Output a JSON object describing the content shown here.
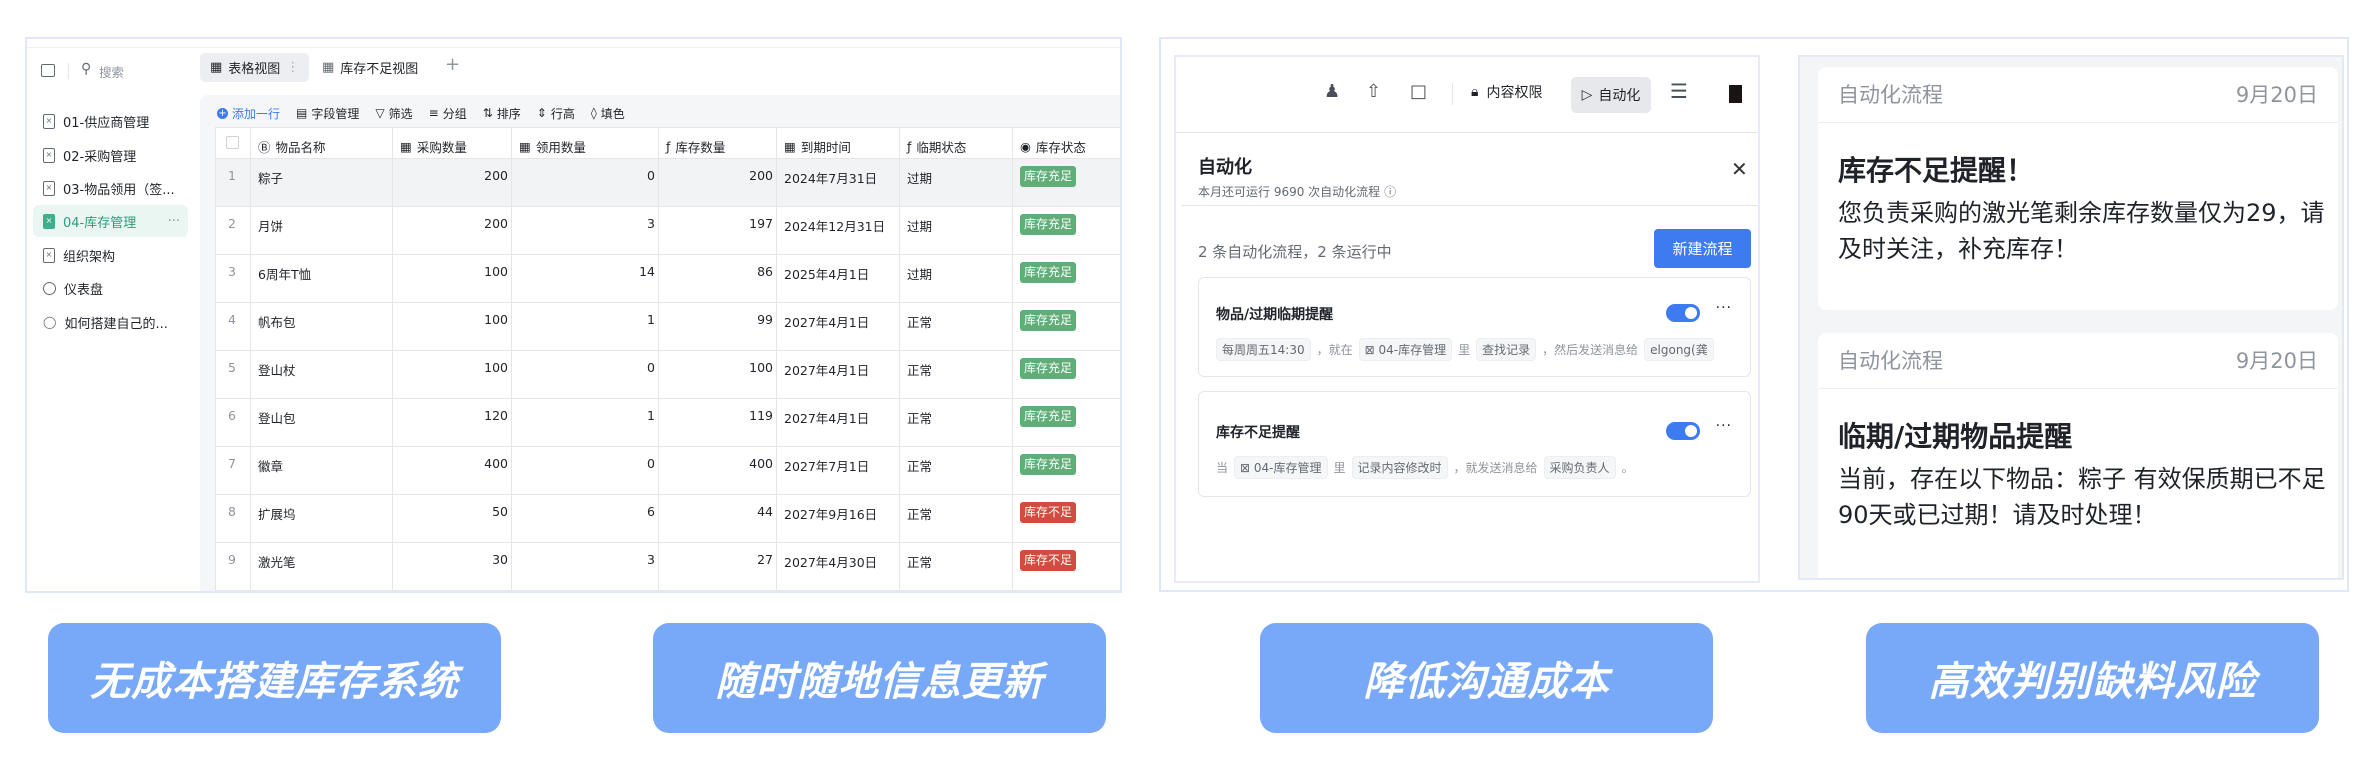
{
  "colors": {
    "accent": "#3c7cf0",
    "feature_button": "#78a8f8",
    "badge_ok": "#5fae78",
    "badge_low": "#d14b3f",
    "active_sheet": "#2d9c7a"
  },
  "sidebar": {
    "search_placeholder": "搜索",
    "items": [
      {
        "label": "01-供应商管理",
        "icon": "sheet-icon"
      },
      {
        "label": "02-采购管理",
        "icon": "sheet-icon"
      },
      {
        "label": "03-物品领用（签...",
        "icon": "sheet-icon"
      },
      {
        "label": "04-库存管理",
        "icon": "sheet-icon",
        "active": true
      },
      {
        "label": "组织架构",
        "icon": "sheet-icon"
      },
      {
        "label": "仪表盘",
        "icon": "dashboard-icon"
      },
      {
        "label": "如何搭建自己的...",
        "icon": "lightbulb-icon"
      }
    ]
  },
  "tabs": [
    {
      "label": "表格视图",
      "active": true
    },
    {
      "label": "库存不足视图"
    }
  ],
  "toolbar": {
    "add_row": "添加一行",
    "fields": "字段管理",
    "filter": "筛选",
    "group": "分组",
    "sort": "排序",
    "row_height": "行高",
    "fill": "填色"
  },
  "table": {
    "columns": [
      "物品名称",
      "采购数量",
      "领用数量",
      "库存数量",
      "到期时间",
      "临期状态",
      "库存状态"
    ],
    "rows": [
      {
        "n": "1",
        "name": "粽子",
        "purchase": "200",
        "used": "0",
        "stock": "200",
        "expire": "2024年7月31日",
        "state": "过期",
        "status": "库存充足",
        "ok": true
      },
      {
        "n": "2",
        "name": "月饼",
        "purchase": "200",
        "used": "3",
        "stock": "197",
        "expire": "2024年12月31日",
        "state": "过期",
        "status": "库存充足",
        "ok": true
      },
      {
        "n": "3",
        "name": "6周年T恤",
        "purchase": "100",
        "used": "14",
        "stock": "86",
        "expire": "2025年4月1日",
        "state": "过期",
        "status": "库存充足",
        "ok": true
      },
      {
        "n": "4",
        "name": "帆布包",
        "purchase": "100",
        "used": "1",
        "stock": "99",
        "expire": "2027年4月1日",
        "state": "正常",
        "status": "库存充足",
        "ok": true
      },
      {
        "n": "5",
        "name": "登山杖",
        "purchase": "100",
        "used": "0",
        "stock": "100",
        "expire": "2027年4月1日",
        "state": "正常",
        "status": "库存充足",
        "ok": true
      },
      {
        "n": "6",
        "name": "登山包",
        "purchase": "120",
        "used": "1",
        "stock": "119",
        "expire": "2027年4月1日",
        "state": "正常",
        "status": "库存充足",
        "ok": true
      },
      {
        "n": "7",
        "name": "徽章",
        "purchase": "400",
        "used": "0",
        "stock": "400",
        "expire": "2027年7月1日",
        "state": "正常",
        "status": "库存充足",
        "ok": true
      },
      {
        "n": "8",
        "name": "扩展坞",
        "purchase": "50",
        "used": "6",
        "stock": "44",
        "expire": "2027年9月16日",
        "state": "正常",
        "status": "库存不足",
        "ok": false
      },
      {
        "n": "9",
        "name": "激光笔",
        "purchase": "30",
        "used": "3",
        "stock": "27",
        "expire": "2027年4月30日",
        "state": "正常",
        "status": "库存不足",
        "ok": false
      }
    ]
  },
  "automation": {
    "topbar": {
      "permissions": "内容权限",
      "automation": "自动化"
    },
    "title": "自动化",
    "subtitle": "本月还可运行 9690 次自动化流程",
    "summary": "2 条自动化流程，2 条运行中",
    "new_button": "新建流程",
    "flows": [
      {
        "title": "物品/过期临期提醒",
        "enabled": true,
        "parts": [
          {
            "t": "每周周五14:30",
            "tag": true
          },
          {
            "t": "，就在"
          },
          {
            "t": "04-库存管理",
            "tag": true,
            "sheet": true
          },
          {
            "t": "里"
          },
          {
            "t": "查找记录",
            "tag": true
          },
          {
            "t": "，然后发送消息给"
          },
          {
            "t": "elgong(龚",
            "tag": true
          }
        ]
      },
      {
        "title": "库存不足提醒",
        "enabled": true,
        "parts": [
          {
            "t": "当"
          },
          {
            "t": "04-库存管理",
            "tag": true,
            "sheet": true
          },
          {
            "t": "里"
          },
          {
            "t": "记录内容修改时",
            "tag": true
          },
          {
            "t": "，就发送消息给"
          },
          {
            "t": "采购负责人",
            "tag": true
          },
          {
            "t": "。"
          }
        ]
      }
    ]
  },
  "notifications": [
    {
      "source": "自动化流程",
      "date": "9月20日",
      "title": "库存不足提醒！",
      "body": "您负责采购的激光笔剩余库存数量仅为29，请及时关注，补充库存！"
    },
    {
      "source": "自动化流程",
      "date": "9月20日",
      "title": "临期/过期物品提醒",
      "body": "当前，存在以下物品：粽子 有效保质期已不足90天或已过期！请及时处理！"
    }
  ],
  "features": [
    "无成本搭建库存系统",
    "随时随地信息更新",
    "降低沟通成本",
    "高效判别缺料风险"
  ]
}
